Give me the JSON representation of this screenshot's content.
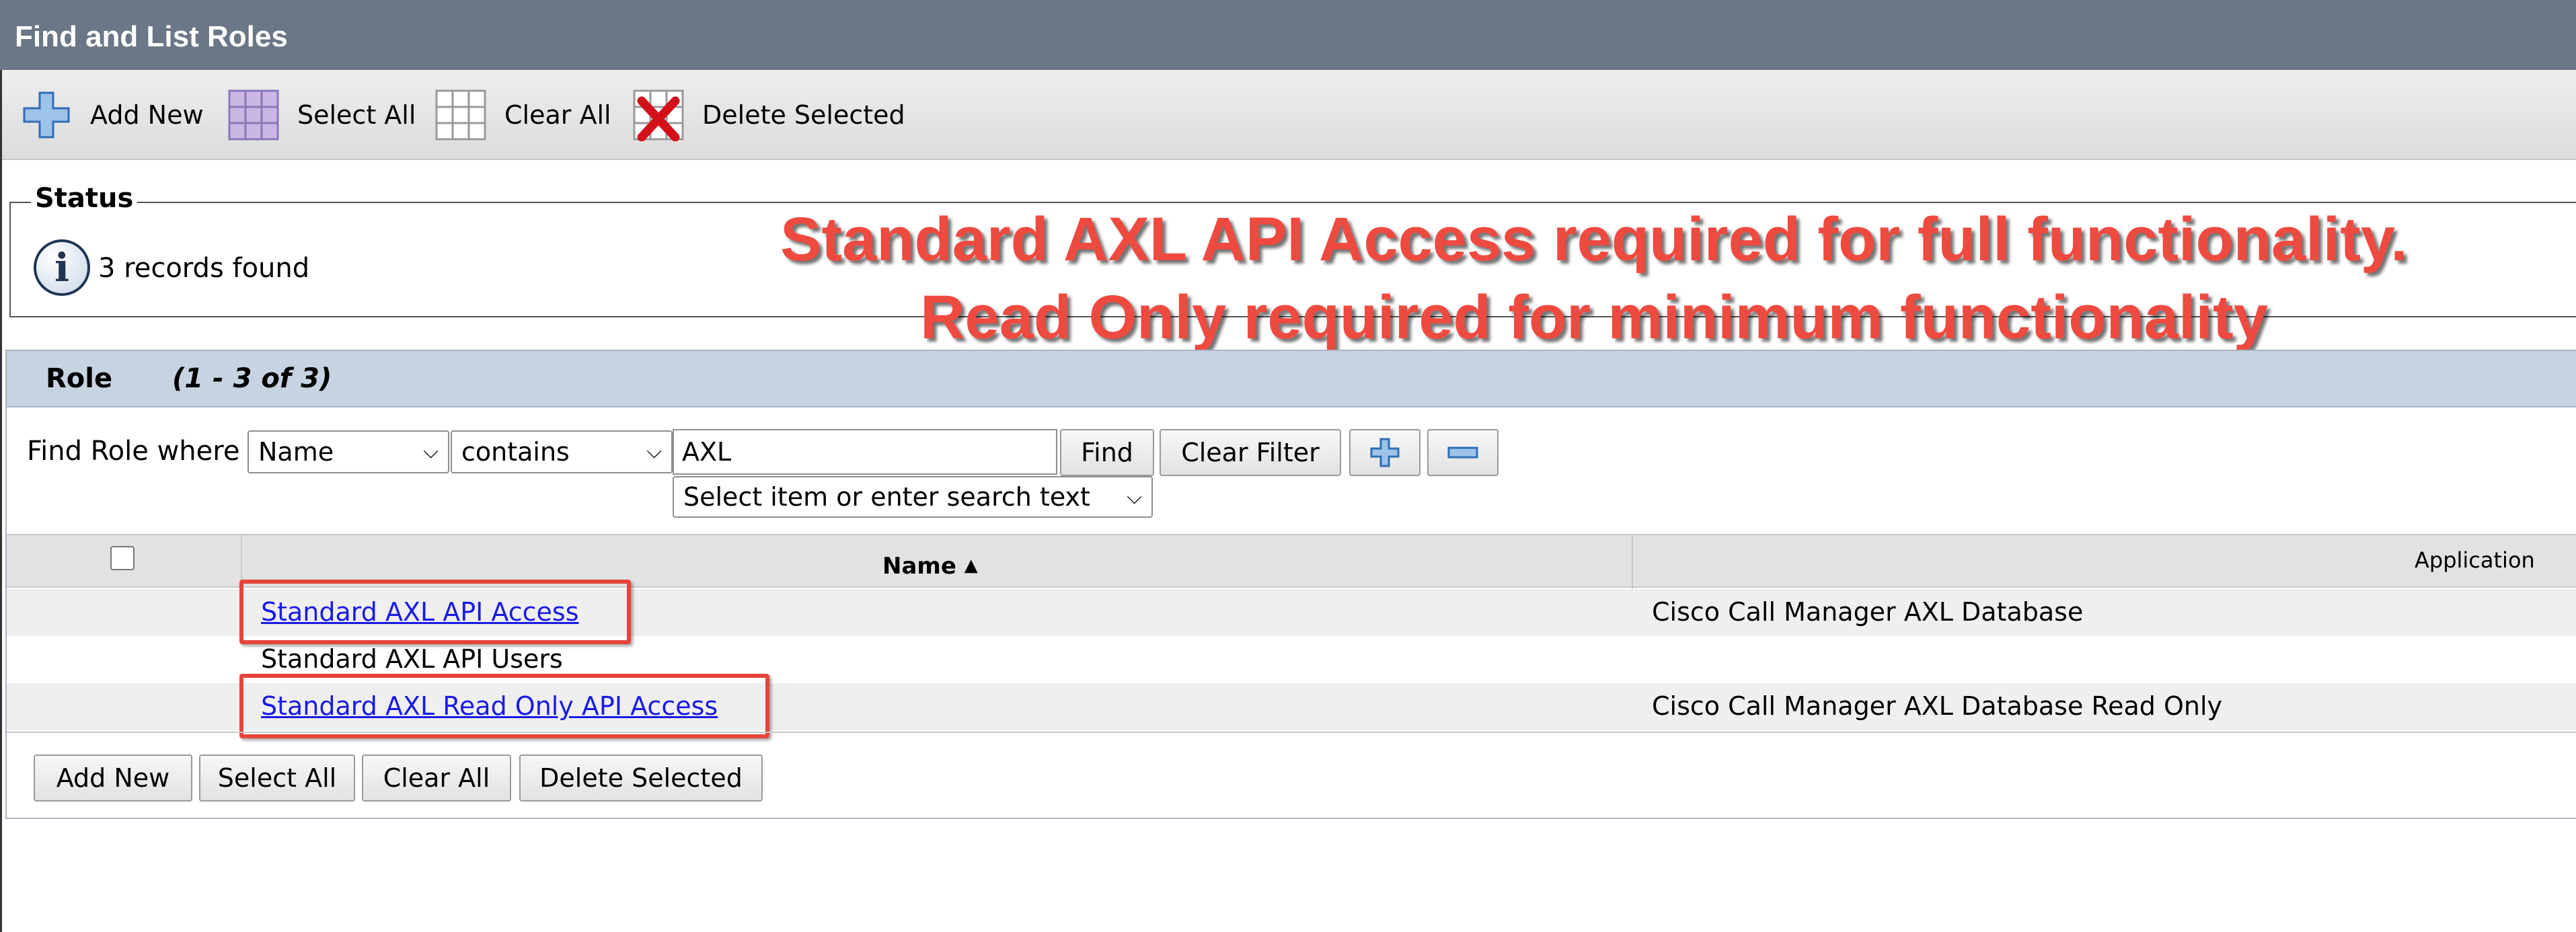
{
  "window": {
    "title": "Find and List Roles"
  },
  "toolbar": {
    "add_new": "Add New",
    "select_all": "Select All",
    "clear_all": "Clear All",
    "delete_selected": "Delete Selected"
  },
  "status": {
    "legend": "Status",
    "message": "3 records found",
    "icon": "info-icon"
  },
  "annotation": {
    "line1": "Standard AXL API Access required for full functionality.",
    "line2": "Read Only required for minimum functionality",
    "color": "#ee4a40"
  },
  "panel": {
    "title": "Role",
    "count": "(1 - 3 of 3)"
  },
  "search": {
    "label": "Find Role where",
    "field": "Name",
    "operator": "contains",
    "value": "AXL",
    "find_button": "Find",
    "clear_filter_button": "Clear Filter",
    "secondary_placeholder": "Select item or enter search text"
  },
  "table": {
    "columns": {
      "name": "Name",
      "application": "Application"
    },
    "rows": [
      {
        "name": "Standard AXL API Access",
        "application": "Cisco Call Manager AXL Database",
        "link": true,
        "highlighted": true
      },
      {
        "name": "Standard AXL API Users",
        "application": "",
        "link": false,
        "highlighted": false
      },
      {
        "name": "Standard AXL Read Only API Access",
        "application": "Cisco Call Manager AXL Database Read Only",
        "link": true,
        "highlighted": true
      }
    ]
  },
  "bottom_buttons": {
    "add_new": "Add New",
    "select_all": "Select All",
    "clear_all": "Clear All",
    "delete_selected": "Delete Selected"
  },
  "colors": {
    "title_bar": "#6b7686",
    "panel_header": "#c7d3e1",
    "link": "#1a1ae6",
    "highlight_box": "#e5443c"
  }
}
